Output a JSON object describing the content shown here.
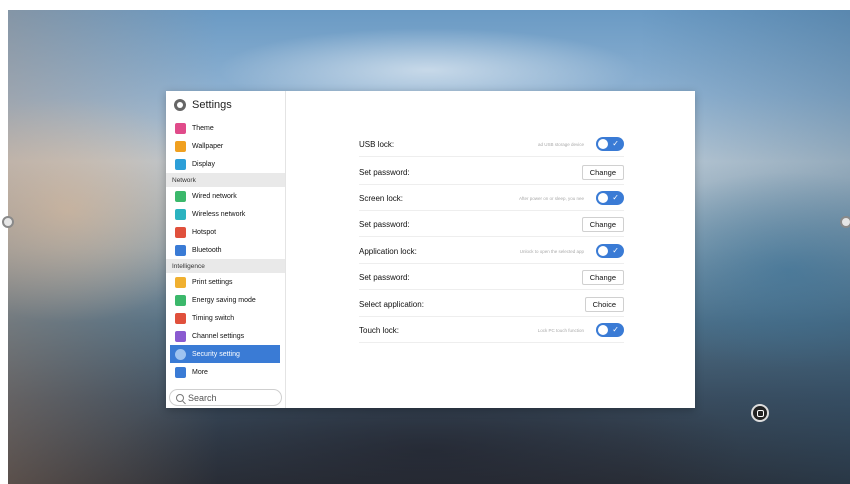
{
  "settings": {
    "title": "Settings",
    "search_placeholder": "Search"
  },
  "sidebar": {
    "items": [
      {
        "label": "Theme",
        "icon": "theme-icon",
        "color": "#e04b8a"
      },
      {
        "label": "Wallpaper",
        "icon": "wallpaper-icon",
        "color": "#f0a020"
      },
      {
        "label": "Display",
        "icon": "display-icon",
        "color": "#2d9fd8"
      },
      {
        "section": "Network"
      },
      {
        "label": "Wired network",
        "icon": "wired-network-icon",
        "color": "#3bb86b"
      },
      {
        "label": "Wireless network",
        "icon": "wifi-icon",
        "color": "#2bb3c0"
      },
      {
        "label": "Hotspot",
        "icon": "hotspot-icon",
        "color": "#e0503c"
      },
      {
        "label": "Bluetooth",
        "icon": "bluetooth-icon",
        "color": "#3a7bd5"
      },
      {
        "section": "Intelligence"
      },
      {
        "label": "Print settings",
        "icon": "print-icon",
        "color": "#f0b030"
      },
      {
        "label": "Energy saving mode",
        "icon": "energy-icon",
        "color": "#3bb86b"
      },
      {
        "label": "Timing switch",
        "icon": "timing-icon",
        "color": "#e0503c"
      },
      {
        "label": "Channel settings",
        "icon": "channel-icon",
        "color": "#8a5bd0"
      },
      {
        "label": "Security setting",
        "icon": "security-icon",
        "color": "#ffffff",
        "active": true
      },
      {
        "label": "More",
        "icon": "more-icon",
        "color": "#3a7bd5"
      }
    ]
  },
  "main": {
    "rows": [
      {
        "label": "USB lock:",
        "hint": "ad USB storage device",
        "control": "toggle"
      },
      {
        "label": "Set password:",
        "button": "Change"
      },
      {
        "label": "Screen lock:",
        "hint": "After power on or sleep, you nee",
        "control": "toggle"
      },
      {
        "label": "Set password:",
        "button": "Change"
      },
      {
        "label": "Application lock:",
        "hint": "Unlock to open the selected app",
        "control": "toggle"
      },
      {
        "label": "Set password:",
        "button": "Change"
      },
      {
        "label": "Select application:",
        "button": "Choice"
      },
      {
        "label": "Touch lock:",
        "hint": "Lock PC touch function",
        "control": "toggle"
      }
    ]
  },
  "colors": {
    "accent": "#3a7bd5",
    "section_bg": "#e9e9e9"
  }
}
